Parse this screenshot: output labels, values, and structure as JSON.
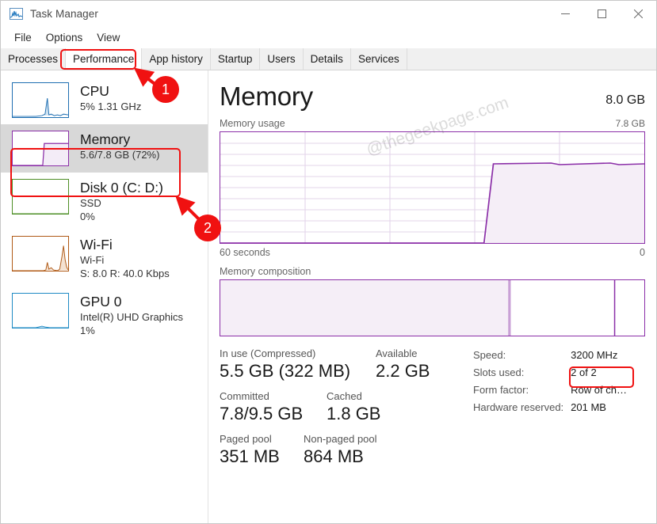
{
  "window": {
    "title": "Task Manager",
    "icon": "chart-icon",
    "controls": {
      "minimize": "minimize-icon",
      "maximize": "maximize-icon",
      "close": "close-icon"
    }
  },
  "menubar": {
    "items": [
      {
        "label": "File"
      },
      {
        "label": "Options"
      },
      {
        "label": "View"
      }
    ]
  },
  "tabs": [
    {
      "label": "Processes",
      "active": false
    },
    {
      "label": "Performance",
      "active": true
    },
    {
      "label": "App history",
      "active": false
    },
    {
      "label": "Startup",
      "active": false
    },
    {
      "label": "Users",
      "active": false
    },
    {
      "label": "Details",
      "active": false
    },
    {
      "label": "Services",
      "active": false
    }
  ],
  "sidebar": {
    "items": [
      {
        "title": "CPU",
        "sub1": "5%  1.31 GHz",
        "sub2": "",
        "color": "#1f6fb2",
        "selected": false
      },
      {
        "title": "Memory",
        "sub1": "5.6/7.8 GB (72%)",
        "sub2": "",
        "color": "#8b2fa8",
        "selected": true
      },
      {
        "title": "Disk 0 (C: D:)",
        "sub1": "SSD",
        "sub2": "0%",
        "color": "#4e8f26",
        "selected": false
      },
      {
        "title": "Wi-Fi",
        "sub1": "Wi-Fi",
        "sub2": "S: 8.0 R: 40.0 Kbps",
        "color": "#b05a16",
        "selected": false
      },
      {
        "title": "GPU 0",
        "sub1": "Intel(R) UHD Graphics",
        "sub2": "1%",
        "color": "#1f8bc4",
        "selected": false
      }
    ]
  },
  "main": {
    "title": "Memory",
    "total": "8.0 GB",
    "usage_label": "Memory usage",
    "usage_max": "7.8 GB",
    "axis_left": "60 seconds",
    "axis_right": "0",
    "composition_label": "Memory composition",
    "accent_color": "#8b2fa8",
    "stats": {
      "in_use_label": "In use (Compressed)",
      "in_use_value": "5.5 GB (322 MB)",
      "available_label": "Available",
      "available_value": "2.2 GB",
      "committed_label": "Committed",
      "committed_value": "7.8/9.5 GB",
      "cached_label": "Cached",
      "cached_value": "1.8 GB",
      "paged_label": "Paged pool",
      "paged_value": "351 MB",
      "nonpaged_label": "Non-paged pool",
      "nonpaged_value": "864 MB"
    },
    "specs": {
      "speed_label": "Speed:",
      "speed_value": "3200 MHz",
      "slots_label": "Slots used:",
      "slots_value": "2 of 2",
      "form_label": "Form factor:",
      "form_value": "Row of ch…",
      "reserved_label": "Hardware reserved:",
      "reserved_value": "201 MB"
    }
  },
  "annotations": {
    "badge_one": "1",
    "badge_two": "2",
    "highlight_color": "#f01111",
    "watermark": "@thegeekpage.com"
  },
  "chart_data": {
    "type": "area",
    "title": "Memory usage",
    "xlabel": "60 seconds",
    "ylabel": "GB",
    "ylim": [
      0,
      7.8
    ],
    "x": [
      0,
      10,
      20,
      30,
      40,
      50,
      55,
      58,
      60,
      62,
      64,
      70,
      78,
      84,
      90,
      100
    ],
    "values": [
      0,
      0,
      0,
      0,
      0,
      0,
      0,
      0,
      0.6,
      5.4,
      5.6,
      5.6,
      5.58,
      5.62,
      5.58,
      5.62
    ],
    "grid": true,
    "legend": false,
    "series_color": "#8b2fa8",
    "fill_color": "#f5eef7"
  }
}
